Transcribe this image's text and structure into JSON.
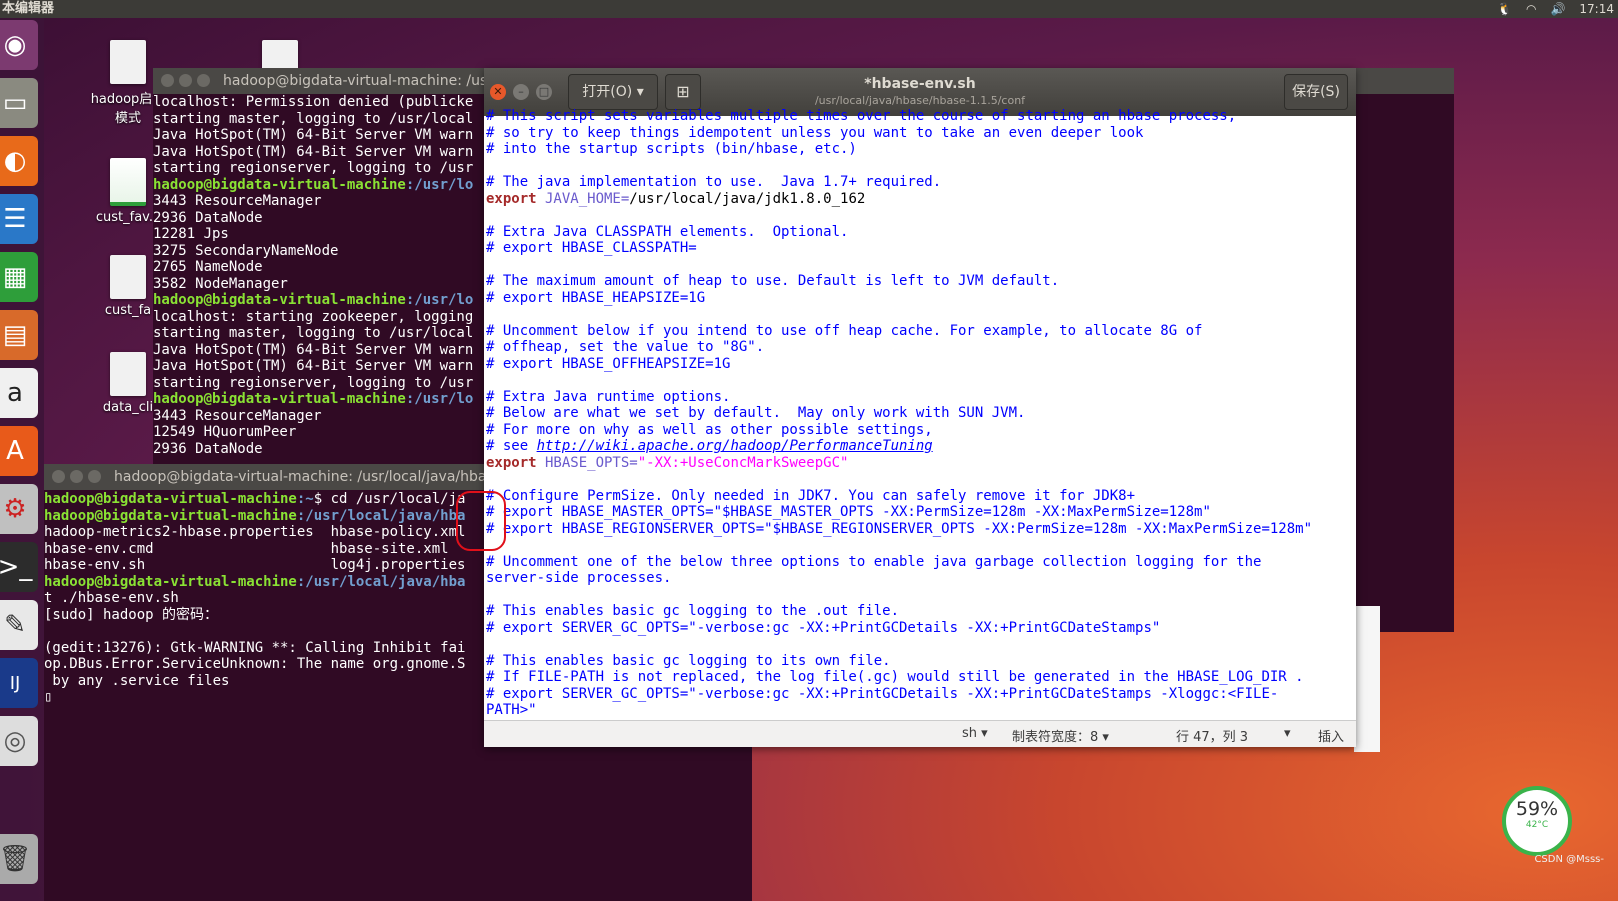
{
  "topbar": {
    "title": "本编辑器",
    "time": "17:14"
  },
  "desktop": {
    "icons": [
      {
        "label": "hadoop启动",
        "label2": "模式"
      },
      {
        "label": "cust_fav.c"
      },
      {
        "label": "cust_fa"
      },
      {
        "label": "data_cli"
      }
    ]
  },
  "term1": {
    "title": "hadoop@bigdata-virtual-machine: /us",
    "lines": [
      {
        "t": "localhost: Permission denied (publicke"
      },
      {
        "t": "starting master, logging to /usr/local"
      },
      {
        "t": "Java HotSpot(TM) 64-Bit Server VM warn"
      },
      {
        "t": "Java HotSpot(TM) 64-Bit Server VM warn"
      },
      {
        "t": "starting regionserver, logging to /usr"
      },
      {
        "p": "hadoop@bigdata-virtual-machine",
        "d": ":/usr/lo"
      },
      {
        "t": "3443 ResourceManager"
      },
      {
        "t": "2936 DataNode"
      },
      {
        "t": "12281 Jps"
      },
      {
        "t": "3275 SecondaryNameNode"
      },
      {
        "t": "2765 NameNode"
      },
      {
        "t": "3582 NodeManager"
      },
      {
        "p": "hadoop@bigdata-virtual-machine",
        "d": ":/usr/lo"
      },
      {
        "t": "localhost: starting zookeeper, logging"
      },
      {
        "t": "starting master, logging to /usr/local"
      },
      {
        "t": "Java HotSpot(TM) 64-Bit Server VM warn"
      },
      {
        "t": "Java HotSpot(TM) 64-Bit Server VM warn"
      },
      {
        "t": "starting regionserver, logging to /usr"
      },
      {
        "p": "hadoop@bigdata-virtual-machine",
        "d": ":/usr/lo"
      },
      {
        "t": "3443 ResourceManager"
      },
      {
        "t": "12549 HQuorumPeer"
      },
      {
        "t": "2936 DataNode"
      }
    ]
  },
  "term2": {
    "title": "hadoop@bigdata-virtual-machine: /usr/local/java/hba",
    "lines": [
      {
        "p": "hadoop@bigdata-virtual-machine",
        "d": ":~",
        "r": "$ cd /usr/local/ja"
      },
      {
        "p": "hadoop@bigdata-virtual-machine",
        "d": ":/usr/local/java/hba"
      },
      {
        "t": "hadoop-metrics2-hbase.properties  hbase-policy.xml"
      },
      {
        "t": "hbase-env.cmd                     hbase-site.xml"
      },
      {
        "t": "hbase-env.sh                      log4j.properties"
      },
      {
        "p": "hadoop@bigdata-virtual-machine",
        "d": ":/usr/local/java/hba"
      },
      {
        "t": "t ./hbase-env.sh"
      },
      {
        "t": "[sudo] hadoop 的密码："
      },
      {
        "t": ""
      },
      {
        "t": "(gedit:13276): Gtk-WARNING **: Calling Inhibit fai"
      },
      {
        "t": "op.DBus.Error.ServiceUnknown: The name org.gnome.S"
      },
      {
        "t": " by any .service files"
      },
      {
        "t": "▯"
      }
    ]
  },
  "gedit": {
    "open_label": "打开(O)",
    "title": "*hbase-env.sh",
    "path": "/usr/local/java/hbase/hbase-1.1.5/conf",
    "save_label": "保存(S)",
    "lines": [
      [
        {
          "c": "c",
          "t": "# This script sets variables multiple times over the course of starting an hbase process,"
        }
      ],
      [
        {
          "c": "c",
          "t": "# so try to keep things idempotent unless you want to take an even deeper look"
        }
      ],
      [
        {
          "c": "c",
          "t": "# into the startup scripts (bin/hbase, etc.)"
        }
      ],
      [
        {
          "c": "",
          "t": ""
        }
      ],
      [
        {
          "c": "c",
          "t": "# The java implementation to use.  Java 1.7+ required."
        }
      ],
      [
        {
          "c": "kw",
          "t": "export"
        },
        {
          "c": "nm",
          "t": " JAVA_HOME="
        },
        {
          "c": "",
          "t": "/usr/local/java/jdk1.8.0_162"
        }
      ],
      [
        {
          "c": "",
          "t": ""
        }
      ],
      [
        {
          "c": "c",
          "t": "# Extra Java CLASSPATH elements.  Optional."
        }
      ],
      [
        {
          "c": "c",
          "t": "# export HBASE_CLASSPATH="
        }
      ],
      [
        {
          "c": "",
          "t": ""
        }
      ],
      [
        {
          "c": "c",
          "t": "# The maximum amount of heap to use. Default is left to JVM default."
        }
      ],
      [
        {
          "c": "c",
          "t": "# export HBASE_HEAPSIZE=1G"
        }
      ],
      [
        {
          "c": "",
          "t": ""
        }
      ],
      [
        {
          "c": "c",
          "t": "# Uncomment below if you intend to use off heap cache. For example, to allocate 8G of"
        }
      ],
      [
        {
          "c": "c",
          "t": "# offheap, set the value to \"8G\"."
        }
      ],
      [
        {
          "c": "c",
          "t": "# export HBASE_OFFHEAPSIZE=1G"
        }
      ],
      [
        {
          "c": "",
          "t": ""
        }
      ],
      [
        {
          "c": "c",
          "t": "# Extra Java runtime options."
        }
      ],
      [
        {
          "c": "c",
          "t": "# Below are what we set by default.  May only work with SUN JVM."
        }
      ],
      [
        {
          "c": "c",
          "t": "# For more on why as well as other possible settings,"
        }
      ],
      [
        {
          "c": "c",
          "t": "# see "
        },
        {
          "c": "url",
          "t": "http://wiki.apache.org/hadoop/PerformanceTuning"
        }
      ],
      [
        {
          "c": "kw",
          "t": "export"
        },
        {
          "c": "nm",
          "t": " HBASE_OPTS="
        },
        {
          "c": "str",
          "t": "\"-XX:+UseConcMarkSweepGC\""
        }
      ],
      [
        {
          "c": "",
          "t": ""
        }
      ],
      [
        {
          "c": "c",
          "t": "# Configure PermSize. Only needed in JDK7. You can safely remove it for JDK8+"
        }
      ],
      [
        {
          "c": "c",
          "t": "# export HBASE_MASTER_OPTS=\"$HBASE_MASTER_OPTS -XX:PermSize=128m -XX:MaxPermSize=128m\""
        }
      ],
      [
        {
          "c": "c",
          "t": "# export HBASE_REGIONSERVER_OPTS=\"$HBASE_REGIONSERVER_OPTS -XX:PermSize=128m -XX:MaxPermSize=128m\""
        }
      ],
      [
        {
          "c": "",
          "t": ""
        }
      ],
      [
        {
          "c": "c",
          "t": "# Uncomment one of the below three options to enable java garbage collection logging for the"
        }
      ],
      [
        {
          "c": "c",
          "t": "server-side processes."
        }
      ],
      [
        {
          "c": "",
          "t": ""
        }
      ],
      [
        {
          "c": "c",
          "t": "# This enables basic gc logging to the .out file."
        }
      ],
      [
        {
          "c": "c",
          "t": "# export SERVER_GC_OPTS=\"-verbose:gc -XX:+PrintGCDetails -XX:+PrintGCDateStamps\""
        }
      ],
      [
        {
          "c": "",
          "t": ""
        }
      ],
      [
        {
          "c": "c",
          "t": "# This enables basic gc logging to its own file."
        }
      ],
      [
        {
          "c": "c",
          "t": "# If FILE-PATH is not replaced, the log file(.gc) would still be generated in the HBASE_LOG_DIR ."
        }
      ],
      [
        {
          "c": "c",
          "t": "# export SERVER_GC_OPTS=\"-verbose:gc -XX:+PrintGCDetails -XX:+PrintGCDateStamps -Xloggc:<FILE-"
        }
      ],
      [
        {
          "c": "c",
          "t": "PATH>\""
        }
      ]
    ],
    "status": {
      "lang": "sh ▾",
      "tab": "制表符宽度：8 ▾",
      "pos": "行 47，列 3",
      "mode": "插入"
    }
  },
  "widget": {
    "percent": "59%",
    "temp": "42°C"
  },
  "watermark": "CSDN @Msss-"
}
